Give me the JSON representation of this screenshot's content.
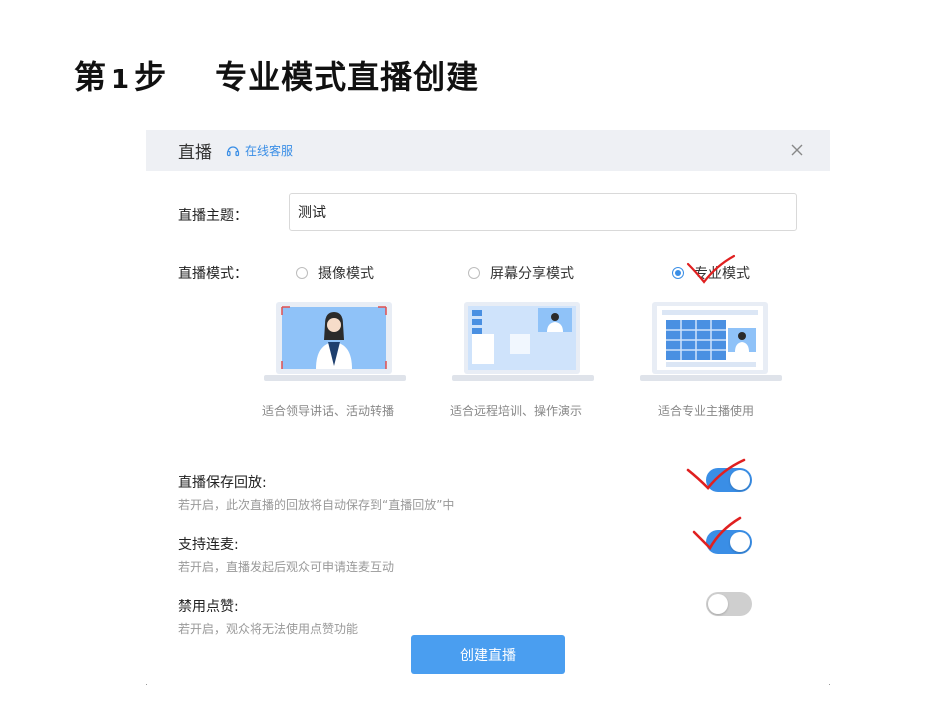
{
  "slide": {
    "step_prefix": "第",
    "step_number": "1",
    "step_suffix": "步",
    "title": "专业模式直播创建"
  },
  "dialog": {
    "title": "直播",
    "support_link": "在线客服",
    "topic_label": "直播主题：",
    "topic_value": "测试",
    "mode_label": "直播模式：",
    "modes": [
      {
        "label": "摄像模式",
        "caption": "适合领导讲话、活动转播",
        "selected": false
      },
      {
        "label": "屏幕分享模式",
        "caption": "适合远程培训、操作演示",
        "selected": false
      },
      {
        "label": "专业模式",
        "caption": "适合专业主播使用",
        "selected": true
      }
    ],
    "settings": [
      {
        "title": "直播保存回放:",
        "desc": "若开启，此次直播的回放将自动保存到“直播回放”中",
        "enabled": true
      },
      {
        "title": "支持连麦:",
        "desc": "若开启，直播发起后观众可申请连麦互动",
        "enabled": true
      },
      {
        "title": "禁用点赞:",
        "desc": "若开启，观众将无法使用点赞功能",
        "enabled": false
      }
    ],
    "create_button": "创建直播"
  },
  "colors": {
    "accent": "#3a8ee6",
    "button": "#4a9ef0",
    "header_bg": "#eef0f4",
    "annotation": "#e02020"
  }
}
